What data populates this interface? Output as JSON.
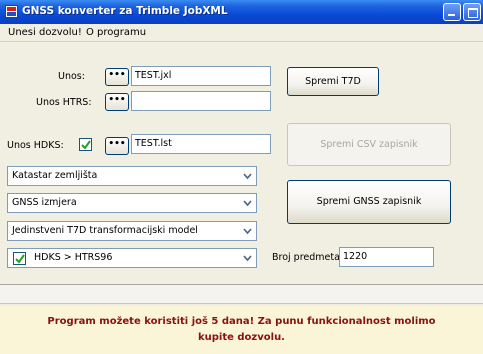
{
  "window": {
    "title": "GNSS konverter za Trimble JobXML"
  },
  "menu": {
    "items": [
      "Unesi dozvolu!",
      "O programu"
    ]
  },
  "inputs": {
    "unos_label": "Unos:",
    "unos_value": "TEST.jxl",
    "htrs_label": "Unos HTRS:",
    "htrs_value": "",
    "hdks_label": "Unos HDKS:",
    "hdks_value": "TEST.lst",
    "dots": "•••"
  },
  "combos": {
    "c1": "Katastar zemljišta",
    "c2": "GNSS izmjera",
    "c3": "Jedinstveni T7D transformacijski model",
    "c4": "HDKS > HTRS96"
  },
  "checkboxes": {
    "hdks_checked": true,
    "transform_checked": true
  },
  "buttons": {
    "spremi_t7d": "Spremi T7D",
    "spremi_csv": "Spremi CSV zapisnik",
    "spremi_gnss": "Spremi GNSS zapisnik"
  },
  "broj": {
    "label": "Broj predmeta:",
    "value": "1220"
  },
  "notice": {
    "line1": "Program možete koristiti još 5 dana! Za punu funkcionalnost molimo",
    "line2": "kupite dozvolu."
  },
  "colors": {
    "title_bar": "#0a4bd6",
    "notice_text": "#8b1010",
    "notice_bg": "#fbf5d8"
  }
}
